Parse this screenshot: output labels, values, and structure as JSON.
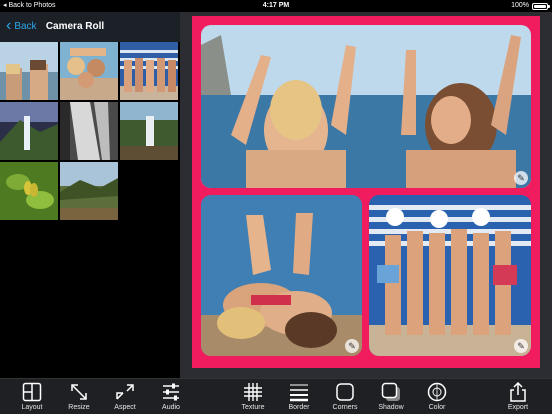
{
  "status_bar": {
    "back_to_app": "Back to Photos",
    "time": "4:17 PM",
    "battery": "100%",
    "battery_level": 1.0
  },
  "camera_roll": {
    "back_label": "Back",
    "title": "Camera Roll"
  },
  "toolbar": {
    "layout": "Layout",
    "resize": "Resize",
    "aspect": "Aspect",
    "audio": "Audio",
    "texture": "Texture",
    "border": "Border",
    "corners": "Corners",
    "shadow": "Shadow",
    "color": "Color",
    "export": "Export"
  },
  "colors": {
    "frame": "#f01c5e",
    "accent": "#2ea6e8",
    "toolbar_bg": "#1e2024",
    "canvas_bg": "#2b2d32"
  },
  "icons": {
    "layout": "layout-icon",
    "resize": "resize-icon",
    "aspect": "aspect-icon",
    "audio": "sliders-icon",
    "texture": "grid-icon",
    "border": "lines-icon",
    "corners": "rounded-square-icon",
    "shadow": "shadow-square-icon",
    "color": "color-wheel-icon",
    "export": "share-icon"
  }
}
